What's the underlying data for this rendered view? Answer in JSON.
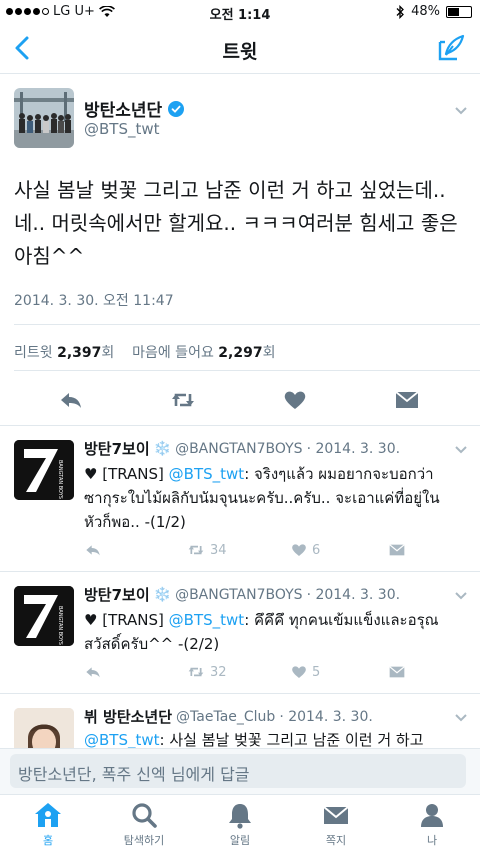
{
  "status_bar": {
    "carrier": "LG U+",
    "time": "오전 1:14",
    "battery": "48%",
    "battery_level": 0.48
  },
  "nav": {
    "title": "트윗"
  },
  "main_tweet": {
    "name": "방탄소년단",
    "handle": "@BTS_twt",
    "text": "사실 봄날 벚꽃 그리고 남준 이런 거 하고 싶었는데.. 네.. 머릿속에서만 할게요.. ㅋㅋㅋ여러분 힘세고 좋은 아침^^",
    "date": "2014. 3. 30. 오전 11:47",
    "retweet_label": "리트윗",
    "retweet_count": "2,397",
    "count_suffix": "회",
    "like_label": "마음에 들어요",
    "like_count": "2,297"
  },
  "replies": [
    {
      "name": "방탄7보이",
      "emoji": "❄️",
      "handle": "@BANGTAN7BOYS",
      "date": "· 2014. 3. 30.",
      "prefix": "♥ [TRANS] ",
      "mention": "@BTS_twt",
      "text": ": จริงๆแล้ว ผมอยากจะบอกว่าซากุระใบไม้ผลิกับนัมจุนนะครับ..ครับ.. จะเอาแค่ที่อยู่ในหัวก็พอ.. -(1/2)",
      "retweets": "34",
      "likes": "6"
    },
    {
      "name": "방탄7보이",
      "emoji": "❄️",
      "handle": "@BANGTAN7BOYS",
      "date": "· 2014. 3. 30.",
      "prefix": "♥ [TRANS] ",
      "mention": "@BTS_twt",
      "text": ": คึคึคึ ทุกคนเข้มแข็งและอรุณสวัสดิ์ครับ^^ -(2/2)",
      "retweets": "32",
      "likes": "5"
    },
    {
      "name": "뷔 방탄소년단",
      "handle": "@TaeTae_Club",
      "date": "· 2014. 3. 30.",
      "mention": "@BTS_twt",
      "text": ": 사실 봄날 벚꽃 그리고 남준 이런 거 하고"
    }
  ],
  "reply_box": {
    "placeholder": "방탄소년단, 폭주 신엑 님에게 답글"
  },
  "tabs": [
    {
      "label": "홈",
      "icon": "home-icon"
    },
    {
      "label": "탐색하기",
      "icon": "search-icon"
    },
    {
      "label": "알림",
      "icon": "bell-icon"
    },
    {
      "label": "쪽지",
      "icon": "envelope-icon"
    },
    {
      "label": "나",
      "icon": "person-icon"
    }
  ],
  "colors": {
    "accent": "#1da1f2",
    "muted": "#657786"
  }
}
